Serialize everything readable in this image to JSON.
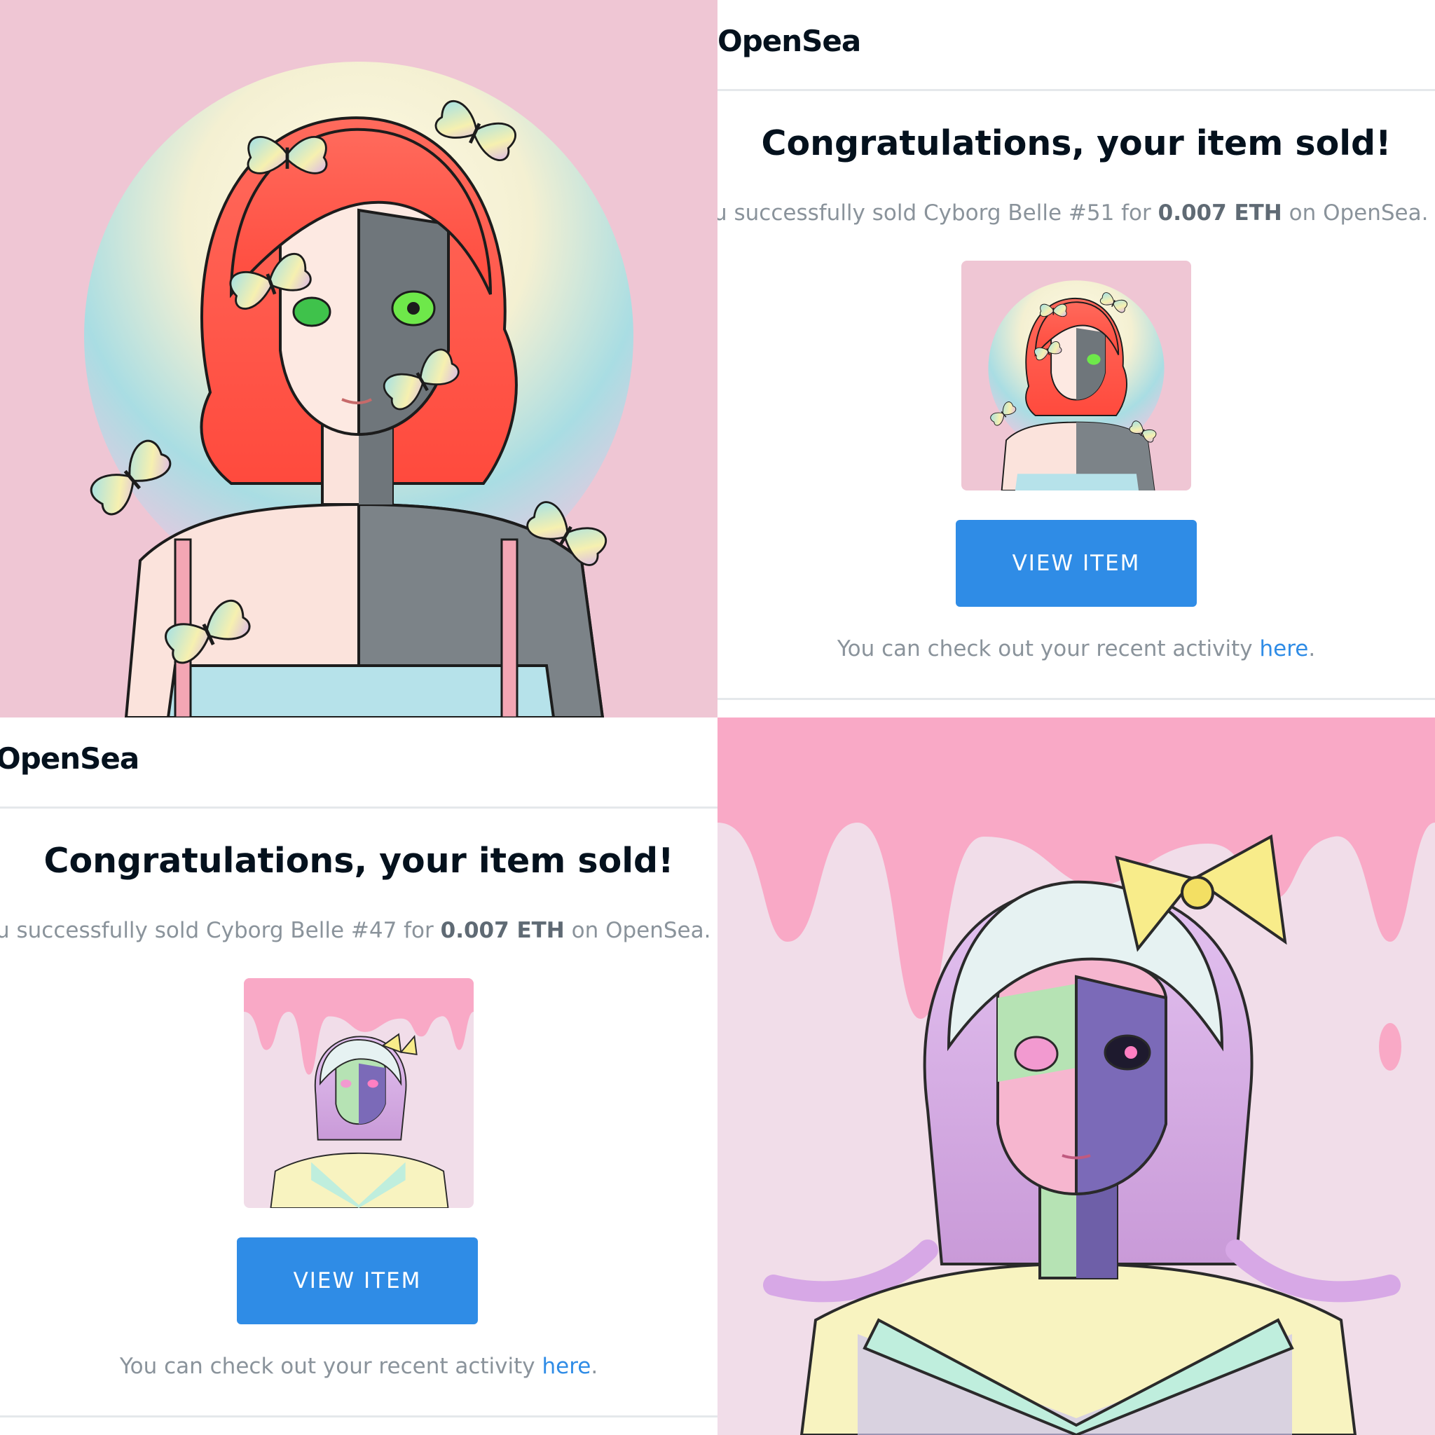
{
  "collage": {
    "panels": [
      {
        "kind": "artwork",
        "subject": "Cyborg Belle #51"
      },
      {
        "kind": "email",
        "brand": "OpenSea",
        "headline": "Congratulations, your item sold!",
        "sold_prefix": "u successfully sold Cyborg Belle #51 for ",
        "price": "0.007 ETH",
        "sold_suffix": " on OpenSea.",
        "button": "VIEW ITEM",
        "activity_prefix": "You can check out your recent activity ",
        "activity_link": "here",
        "activity_suffix": "."
      },
      {
        "kind": "email",
        "brand": "OpenSea",
        "headline": "Congratulations, your item sold!",
        "sold_prefix": "u successfully sold Cyborg Belle #47 for ",
        "price": "0.007 ETH",
        "sold_suffix": " on OpenSea.",
        "button": "VIEW ITEM",
        "activity_prefix": "You can check out your recent activity ",
        "activity_link": "here",
        "activity_suffix": "."
      },
      {
        "kind": "artwork",
        "subject": "Cyborg Belle #47"
      }
    ]
  },
  "colors": {
    "button_blue": "#2f8ce6",
    "brand_text": "#04111d",
    "muted_text": "#8a939b",
    "divider": "#e5e8eb",
    "pink_bg": "#efc6d4",
    "drip_pink": "#f9a9c6"
  }
}
